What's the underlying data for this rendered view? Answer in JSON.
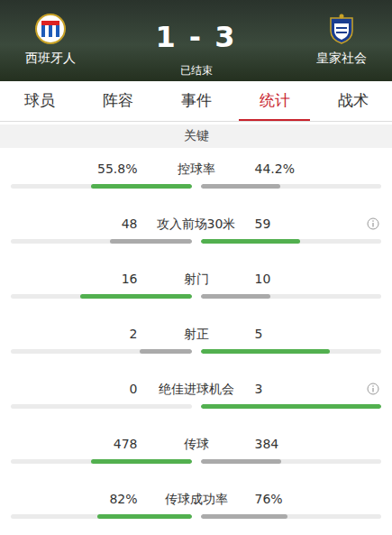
{
  "header": {
    "home": {
      "name": "西班牙人"
    },
    "away": {
      "name": "皇家社会"
    },
    "score": "1 - 3",
    "status": "已结束"
  },
  "tabs": [
    {
      "label": "球员",
      "selected": false
    },
    {
      "label": "阵容",
      "selected": false
    },
    {
      "label": "事件",
      "selected": false
    },
    {
      "label": "统计",
      "selected": true
    },
    {
      "label": "战术",
      "selected": false
    }
  ],
  "section": {
    "title": "关键"
  },
  "stats": [
    {
      "label": "控球率",
      "info": false,
      "home": {
        "value": "55.8%",
        "level": 0.558,
        "highlighted": true
      },
      "away": {
        "value": "44.2%",
        "level": 0.442,
        "highlighted": false
      }
    },
    {
      "label": "攻入前场30米",
      "info": true,
      "home": {
        "value": "48",
        "level": 0.449,
        "highlighted": false
      },
      "away": {
        "value": "59",
        "level": 0.551,
        "highlighted": true
      }
    },
    {
      "label": "射门",
      "info": false,
      "home": {
        "value": "16",
        "level": 0.615,
        "highlighted": true
      },
      "away": {
        "value": "10",
        "level": 0.385,
        "highlighted": false
      }
    },
    {
      "label": "射正",
      "info": false,
      "home": {
        "value": "2",
        "level": 0.286,
        "highlighted": false
      },
      "away": {
        "value": "5",
        "level": 0.714,
        "highlighted": true
      }
    },
    {
      "label": "绝佳进球机会",
      "info": true,
      "home": {
        "value": "0",
        "level": 0,
        "highlighted": false
      },
      "away": {
        "value": "3",
        "level": 1,
        "highlighted": true
      }
    },
    {
      "label": "传球",
      "info": false,
      "home": {
        "value": "478",
        "level": 0.555,
        "highlighted": true
      },
      "away": {
        "value": "384",
        "level": 0.445,
        "highlighted": false
      }
    },
    {
      "label": "传球成功率",
      "info": false,
      "home": {
        "value": "82%",
        "level": 0.519,
        "highlighted": true
      },
      "away": {
        "value": "76%",
        "level": 0.481,
        "highlighted": false
      }
    }
  ]
}
